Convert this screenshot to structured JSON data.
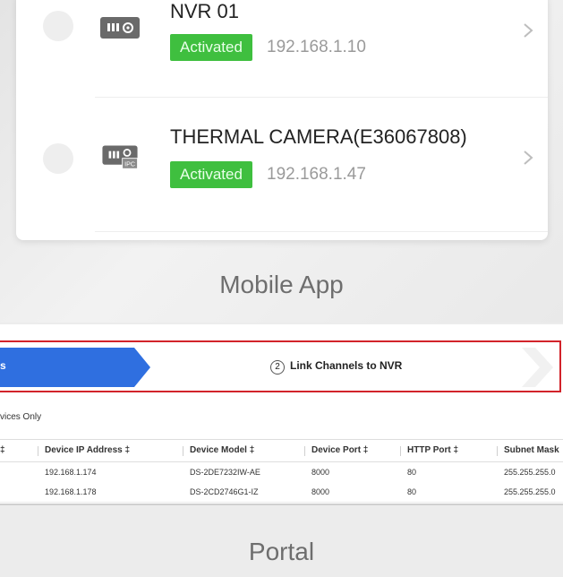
{
  "mobile": {
    "devices": [
      {
        "name": "NVR 01",
        "status": "Activated",
        "ip": "192.168.1.10",
        "icon": "nvr-device-icon"
      },
      {
        "name": "THERMAL CAMERA(E36067808)",
        "status": "Activated",
        "ip": "192.168.1.47",
        "icon": "ipc-device-icon"
      }
    ],
    "caption": "Mobile App"
  },
  "portal": {
    "steps": {
      "step1_label": "s",
      "step2_number": "2",
      "step2_label": "Link Channels to NVR"
    },
    "filter_text": "vices Only",
    "table": {
      "columns": [
        "‡",
        "Device IP Address ‡",
        "Device Model ‡",
        "Device Port ‡",
        "HTTP Port ‡",
        "Subnet Mask"
      ],
      "rows": [
        [
          "",
          "192.168.1.174",
          "DS-2DE7232IW-AE",
          "8000",
          "80",
          "255.255.255.0"
        ],
        [
          "",
          "192.168.1.178",
          "DS-2CD2746G1-IZ",
          "8000",
          "80",
          "255.255.255.0"
        ]
      ]
    },
    "caption": "Portal"
  },
  "colors": {
    "activated_badge": "#3fbf3f",
    "step_active": "#2f6fe0",
    "highlight_border": "#d2232a"
  }
}
